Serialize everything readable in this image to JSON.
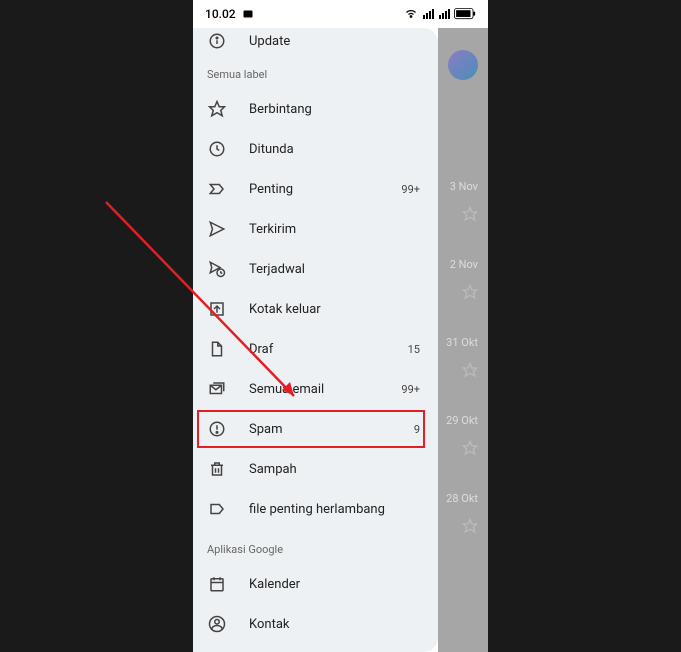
{
  "status": {
    "time": "10.02",
    "indicators": [
      "wifi-icon",
      "signal-icon",
      "signal-icon-2",
      "battery-icon"
    ]
  },
  "drawer": {
    "top_item": {
      "label": "Update"
    },
    "section1_title": "Semua label",
    "section1_items": [
      {
        "label": "Berbintang",
        "count": ""
      },
      {
        "label": "Ditunda",
        "count": ""
      },
      {
        "label": "Penting",
        "count": "99+"
      },
      {
        "label": "Terkirim",
        "count": ""
      },
      {
        "label": "Terjadwal",
        "count": ""
      },
      {
        "label": "Kotak keluar",
        "count": ""
      },
      {
        "label": "Draf",
        "count": "15"
      },
      {
        "label": "Semua email",
        "count": "99+"
      },
      {
        "label": "Spam",
        "count": "9"
      },
      {
        "label": "Sampah",
        "count": ""
      },
      {
        "label": "file penting herlambang",
        "count": ""
      }
    ],
    "section2_title": "Aplikasi Google",
    "section2_items": [
      {
        "label": "Kalender"
      },
      {
        "label": "Kontak"
      }
    ]
  },
  "bg": {
    "dates": [
      "3 Nov",
      "2 Nov",
      "31 Okt",
      "29 Okt",
      "28 Okt"
    ]
  }
}
